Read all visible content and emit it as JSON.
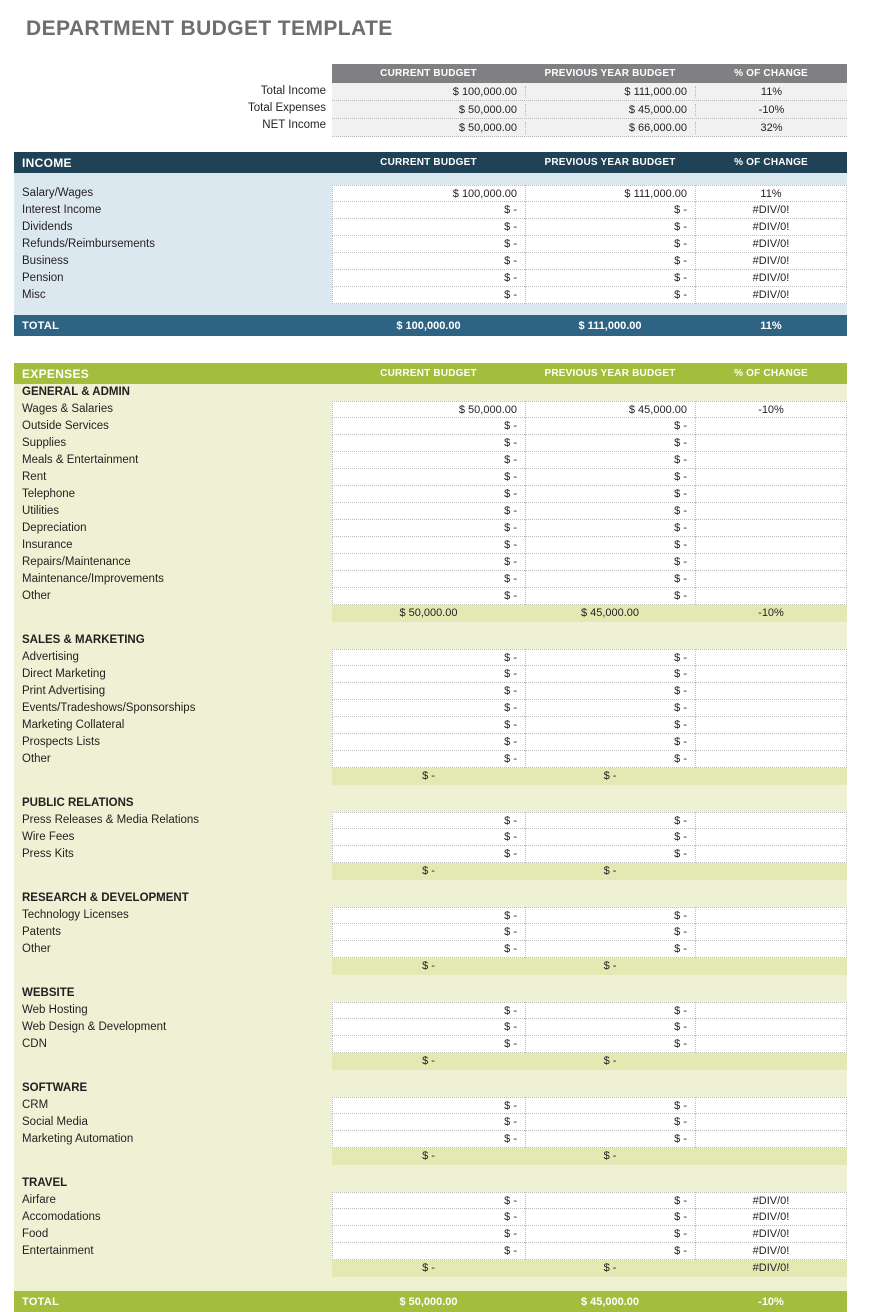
{
  "page": {
    "title": "DEPARTMENT BUDGET TEMPLATE"
  },
  "colors": {
    "title_gray": "#6d6e70",
    "summary_header_gray": "#808083",
    "income_banner": "#1f4257",
    "income_body": "#dce8f0",
    "income_total": "#2f6383",
    "expenses_banner": "#a3bd3c",
    "expenses_body": "#eef1d4",
    "subtotal": "#e3e9b2",
    "expenses_total": "#a3bd3c"
  },
  "columns": {
    "current": "CURRENT BUDGET",
    "previous": "PREVIOUS YEAR BUDGET",
    "change": "% OF CHANGE"
  },
  "summary": {
    "rows": [
      {
        "label": "Total Income",
        "current": "$ 100,000.00",
        "previous": "$ 111,000.00",
        "change": "11%"
      },
      {
        "label": "Total Expenses",
        "current": "$ 50,000.00",
        "previous": "$ 45,000.00",
        "change": "-10%"
      },
      {
        "label": "NET Income",
        "current": "$ 50,000.00",
        "previous": "$ 66,000.00",
        "change": "32%"
      }
    ]
  },
  "income": {
    "banner": "INCOME",
    "rows": [
      {
        "label": "Salary/Wages",
        "current": "$ 100,000.00",
        "previous": "$ 111,000.00",
        "change": "11%"
      },
      {
        "label": "Interest Income",
        "current": "$ -",
        "previous": "$ -",
        "change": "#DIV/0!"
      },
      {
        "label": "Dividends",
        "current": "$ -",
        "previous": "$ -",
        "change": "#DIV/0!"
      },
      {
        "label": "Refunds/Reimbursements",
        "current": "$ -",
        "previous": "$ -",
        "change": "#DIV/0!"
      },
      {
        "label": "Business",
        "current": "$ -",
        "previous": "$ -",
        "change": "#DIV/0!"
      },
      {
        "label": "Pension",
        "current": "$ -",
        "previous": "$ -",
        "change": "#DIV/0!"
      },
      {
        "label": "Misc",
        "current": "$ -",
        "previous": "$ -",
        "change": "#DIV/0!"
      }
    ],
    "total": {
      "label": "TOTAL",
      "current": "$ 100,000.00",
      "previous": "$ 111,000.00",
      "change": "11%"
    }
  },
  "expenses": {
    "banner": "EXPENSES",
    "groups": [
      {
        "name": "GENERAL & ADMIN",
        "rows": [
          {
            "label": "Wages & Salaries",
            "current": "$ 50,000.00",
            "previous": "$ 45,000.00",
            "change": "-10%"
          },
          {
            "label": "Outside Services",
            "current": "$ -",
            "previous": "$ -",
            "change": ""
          },
          {
            "label": "Supplies",
            "current": "$ -",
            "previous": "$ -",
            "change": ""
          },
          {
            "label": "Meals & Entertainment",
            "current": "$ -",
            "previous": "$ -",
            "change": ""
          },
          {
            "label": "Rent",
            "current": "$ -",
            "previous": "$ -",
            "change": ""
          },
          {
            "label": "Telephone",
            "current": "$ -",
            "previous": "$ -",
            "change": ""
          },
          {
            "label": "Utilities",
            "current": "$ -",
            "previous": "$ -",
            "change": ""
          },
          {
            "label": "Depreciation",
            "current": "$ -",
            "previous": "$ -",
            "change": ""
          },
          {
            "label": "Insurance",
            "current": "$ -",
            "previous": "$ -",
            "change": ""
          },
          {
            "label": "Repairs/Maintenance",
            "current": "$ -",
            "previous": "$ -",
            "change": ""
          },
          {
            "label": "Maintenance/Improvements",
            "current": "$ -",
            "previous": "$ -",
            "change": ""
          },
          {
            "label": "Other",
            "current": "$ -",
            "previous": "$ -",
            "change": ""
          }
        ],
        "subtotal": {
          "current": "$ 50,000.00",
          "previous": "$ 45,000.00",
          "change": "-10%"
        }
      },
      {
        "name": "SALES & MARKETING",
        "rows": [
          {
            "label": "Advertising",
            "current": "$ -",
            "previous": "$ -",
            "change": ""
          },
          {
            "label": "Direct Marketing",
            "current": "$ -",
            "previous": "$ -",
            "change": ""
          },
          {
            "label": "Print Advertising",
            "current": "$ -",
            "previous": "$ -",
            "change": ""
          },
          {
            "label": "Events/Tradeshows/Sponsorships",
            "current": "$ -",
            "previous": "$ -",
            "change": ""
          },
          {
            "label": "Marketing Collateral",
            "current": "$ -",
            "previous": "$ -",
            "change": ""
          },
          {
            "label": "Prospects Lists",
            "current": "$ -",
            "previous": "$ -",
            "change": ""
          },
          {
            "label": "Other",
            "current": "$ -",
            "previous": "$ -",
            "change": ""
          }
        ],
        "subtotal": {
          "current": "$ -",
          "previous": "$ -",
          "change": ""
        }
      },
      {
        "name": "PUBLIC RELATIONS",
        "rows": [
          {
            "label": "Press Releases & Media Relations",
            "current": "$ -",
            "previous": "$ -",
            "change": ""
          },
          {
            "label": "Wire Fees",
            "current": "$ -",
            "previous": "$ -",
            "change": ""
          },
          {
            "label": "Press Kits",
            "current": "$ -",
            "previous": "$ -",
            "change": ""
          }
        ],
        "subtotal": {
          "current": "$ -",
          "previous": "$ -",
          "change": ""
        }
      },
      {
        "name": "RESEARCH & DEVELOPMENT",
        "rows": [
          {
            "label": "Technology Licenses",
            "current": "$ -",
            "previous": "$ -",
            "change": ""
          },
          {
            "label": "Patents",
            "current": "$ -",
            "previous": "$ -",
            "change": ""
          },
          {
            "label": "Other",
            "current": "$ -",
            "previous": "$ -",
            "change": ""
          }
        ],
        "subtotal": {
          "current": "$ -",
          "previous": "$ -",
          "change": ""
        }
      },
      {
        "name": "WEBSITE",
        "rows": [
          {
            "label": "Web Hosting",
            "current": "$ -",
            "previous": "$ -",
            "change": ""
          },
          {
            "label": "Web Design & Development",
            "current": "$ -",
            "previous": "$ -",
            "change": ""
          },
          {
            "label": "CDN",
            "current": "$ -",
            "previous": "$ -",
            "change": ""
          }
        ],
        "subtotal": {
          "current": "$ -",
          "previous": "$ -",
          "change": ""
        }
      },
      {
        "name": "SOFTWARE",
        "rows": [
          {
            "label": "CRM",
            "current": "$ -",
            "previous": "$ -",
            "change": ""
          },
          {
            "label": "Social Media",
            "current": "$ -",
            "previous": "$ -",
            "change": ""
          },
          {
            "label": "Marketing Automation",
            "current": "$ -",
            "previous": "$ -",
            "change": ""
          }
        ],
        "subtotal": {
          "current": "$ -",
          "previous": "$ -",
          "change": ""
        }
      },
      {
        "name": "TRAVEL",
        "rows": [
          {
            "label": "Airfare",
            "current": "$ -",
            "previous": "$ -",
            "change": "#DIV/0!"
          },
          {
            "label": "Accomodations",
            "current": "$ -",
            "previous": "$ -",
            "change": "#DIV/0!"
          },
          {
            "label": "Food",
            "current": "$ -",
            "previous": "$ -",
            "change": "#DIV/0!"
          },
          {
            "label": "Entertainment",
            "current": "$ -",
            "previous": "$ -",
            "change": "#DIV/0!"
          }
        ],
        "subtotal": {
          "current": "$ -",
          "previous": "$ -",
          "change": "#DIV/0!"
        }
      }
    ],
    "total": {
      "label": "TOTAL",
      "current": "$ 50,000.00",
      "previous": "$ 45,000.00",
      "change": "-10%"
    }
  }
}
